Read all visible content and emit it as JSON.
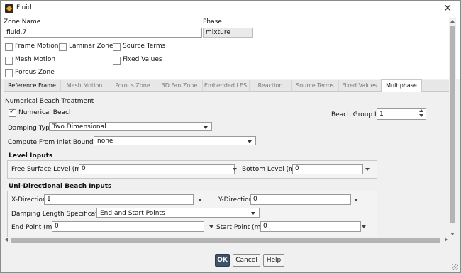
{
  "window": {
    "title": "Fluid",
    "close_symbol": "✕"
  },
  "zone": {
    "name_label": "Zone Name",
    "name_value": "fluid.7",
    "phase_label": "Phase",
    "phase_value": "mixture"
  },
  "options": {
    "frame_motion": {
      "label": "Frame Motion",
      "checked": false
    },
    "laminar_zone": {
      "label": "Laminar Zone",
      "checked": false
    },
    "source_terms": {
      "label": "Source Terms",
      "checked": false
    },
    "mesh_motion": {
      "label": "Mesh Motion",
      "checked": false
    },
    "fixed_values": {
      "label": "Fixed Values",
      "checked": false
    },
    "porous_zone": {
      "label": "Porous Zone",
      "checked": false
    }
  },
  "tabs": [
    "Reference Frame",
    "Mesh Motion",
    "Porous Zone",
    "3D Fan Zone",
    "Embedded LES",
    "Reaction",
    "Source Terms",
    "Fixed Values",
    "Multiphase"
  ],
  "active_tab": "Multiphase",
  "beach": {
    "section_title": "Numerical Beach Treatment",
    "numerical_beach_label": "Numerical Beach",
    "numerical_beach_checked": true,
    "group_id_label": "Beach Group ID",
    "group_id_value": "1",
    "damping_type_label": "Damping Type",
    "damping_type_value": "Two Dimensional",
    "inlet_boundary_label": "Compute From Inlet Boundary",
    "inlet_boundary_value": "none"
  },
  "level_inputs": {
    "title": "Level Inputs",
    "free_surface_label": "Free Surface Level (m)",
    "free_surface_value": "0",
    "bottom_label": "Bottom Level (m)",
    "bottom_value": "0"
  },
  "uni_inputs": {
    "title": "Uni-Directional Beach Inputs",
    "x_label": "X-Direction",
    "x_value": "1",
    "y_label": "Y-Direction",
    "y_value": "0",
    "damping_spec_label": "Damping Length Specification",
    "damping_spec_value": "End and Start Points",
    "end_label": "End Point (m)",
    "end_value": "0",
    "start_label": "Start Point (m)",
    "start_value": "0"
  },
  "buttons": {
    "ok": "OK",
    "cancel": "Cancel",
    "help": "Help"
  }
}
